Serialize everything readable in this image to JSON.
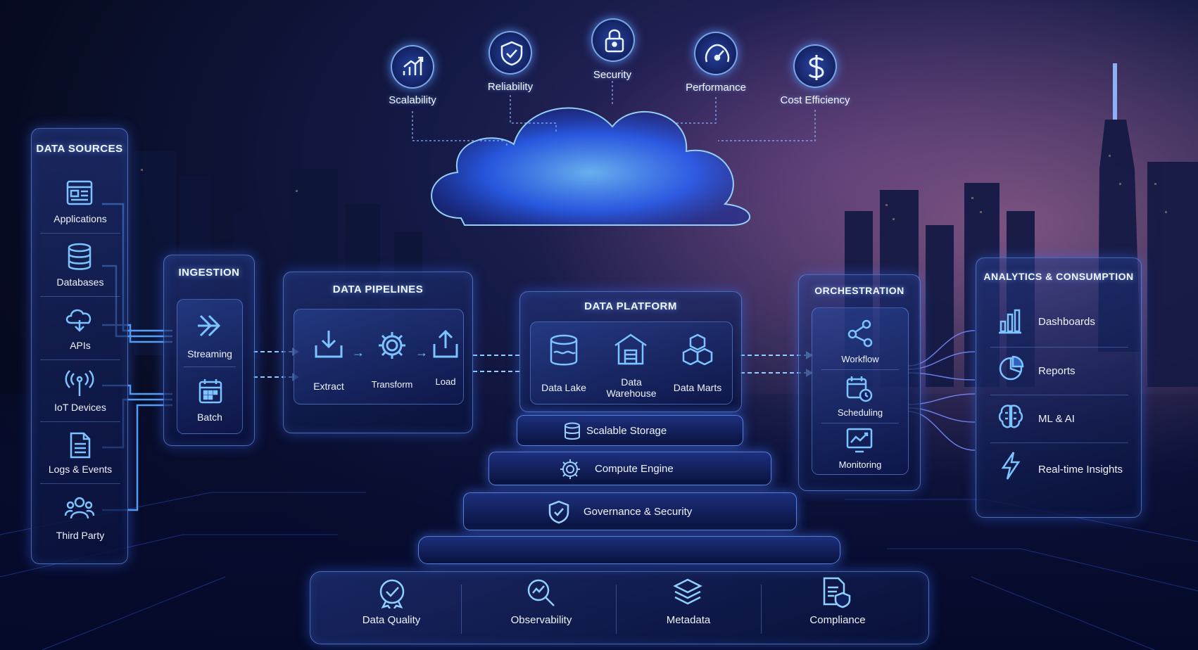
{
  "pillars": [
    {
      "label": "Scalability",
      "icon": "chart-growth-icon"
    },
    {
      "label": "Reliability",
      "icon": "shield-check-icon"
    },
    {
      "label": "Security",
      "icon": "lock-icon"
    },
    {
      "label": "Performance",
      "icon": "speedometer-icon"
    },
    {
      "label": "Cost Efficiency",
      "icon": "dollar-icon"
    }
  ],
  "data_sources": {
    "title": "DATA SOURCES",
    "items": [
      {
        "label": "Applications",
        "icon": "application-window-icon"
      },
      {
        "label": "Databases",
        "icon": "database-icon"
      },
      {
        "label": "APIs",
        "icon": "cloud-api-icon"
      },
      {
        "label": "IoT Devices",
        "icon": "antenna-icon"
      },
      {
        "label": "Logs & Events",
        "icon": "document-log-icon"
      },
      {
        "label": "Third Party",
        "icon": "people-icon"
      }
    ]
  },
  "ingestion": {
    "title": "INGESTION",
    "items": [
      {
        "label": "Streaming",
        "icon": "double-chevron-icon"
      },
      {
        "label": "Batch",
        "icon": "calendar-grid-icon"
      }
    ]
  },
  "pipelines": {
    "title": "DATA PIPELINES",
    "items": [
      {
        "label": "Extract",
        "icon": "download-tray-icon"
      },
      {
        "label": "Transform",
        "icon": "gear-icon"
      },
      {
        "label": "Load",
        "icon": "upload-tray-icon"
      }
    ]
  },
  "platform": {
    "title": "DATA PLATFORM",
    "items": [
      {
        "label": "Data Lake",
        "icon": "lake-cylinder-icon"
      },
      {
        "label": "Data\nWarehouse",
        "icon": "warehouse-icon"
      },
      {
        "label": "Data Marts",
        "icon": "cubes-icon"
      }
    ],
    "tiers": [
      {
        "label": "Scalable Storage",
        "icon": "database-icon"
      },
      {
        "label": "Compute Engine",
        "icon": "chip-gear-icon"
      },
      {
        "label": "Governance & Security",
        "icon": "shield-check-icon"
      }
    ]
  },
  "orchestration": {
    "title": "ORCHESTRATION",
    "items": [
      {
        "label": "Workflow",
        "icon": "workflow-nodes-icon"
      },
      {
        "label": "Scheduling",
        "icon": "calendar-clock-icon"
      },
      {
        "label": "Monitoring",
        "icon": "monitor-chart-icon"
      }
    ]
  },
  "analytics": {
    "title": "ANALYTICS & CONSUMPTION",
    "items": [
      {
        "label": "Dashboards",
        "icon": "bar-chart-icon"
      },
      {
        "label": "Reports",
        "icon": "pie-chart-icon"
      },
      {
        "label": "ML & AI",
        "icon": "brain-icon"
      },
      {
        "label": "Real-time Insights",
        "icon": "lightning-icon"
      }
    ]
  },
  "foundation": [
    {
      "label": "Data Quality",
      "icon": "badge-check-icon"
    },
    {
      "label": "Observability",
      "icon": "magnifier-chart-icon"
    },
    {
      "label": "Metadata",
      "icon": "layers-stack-icon"
    },
    {
      "label": "Compliance",
      "icon": "document-shield-icon"
    }
  ],
  "colors": {
    "accent": "#4f8dff",
    "glow": "#6fb4ff",
    "panel_border": "#78aaff",
    "sky_top": "#070b22",
    "sky_warm": "#3a2a6a"
  }
}
